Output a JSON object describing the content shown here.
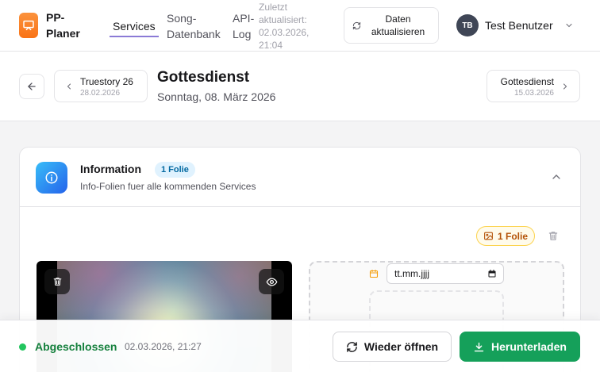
{
  "app": {
    "title": "PP-Planer",
    "logo_icon": "presentation-icon",
    "accent": "#f97316"
  },
  "nav": {
    "services": "Services",
    "song_db": "Song-Datenbank",
    "api_log": "API-Log",
    "last_update": "Zuletzt aktualisiert: 02.03.2026, 21:04",
    "refresh_label": "Daten aktualisieren"
  },
  "user": {
    "initials": "TB",
    "name": "Test Benutzer"
  },
  "service": {
    "title": "Gottesdienst",
    "subtitle": "Sonntag, 08. März 2026",
    "prev": {
      "name": "Truestory 26",
      "date": "28.02.2026"
    },
    "next": {
      "name": "Gottesdienst",
      "date": "15.03.2026"
    }
  },
  "info_card": {
    "title": "Information",
    "badge": "1 Folie",
    "description": "Info-Folien fuer alle kommenden Services",
    "slide_count": "1 Folie",
    "date_placeholder": "tt.mm.jjjj"
  },
  "footer": {
    "status": "Abgeschlossen",
    "status_time": "02.03.2026, 21:27",
    "reopen": "Wieder öffnen",
    "download": "Herunterladen",
    "status_color": "#22c55e",
    "download_color": "#15a05a"
  }
}
